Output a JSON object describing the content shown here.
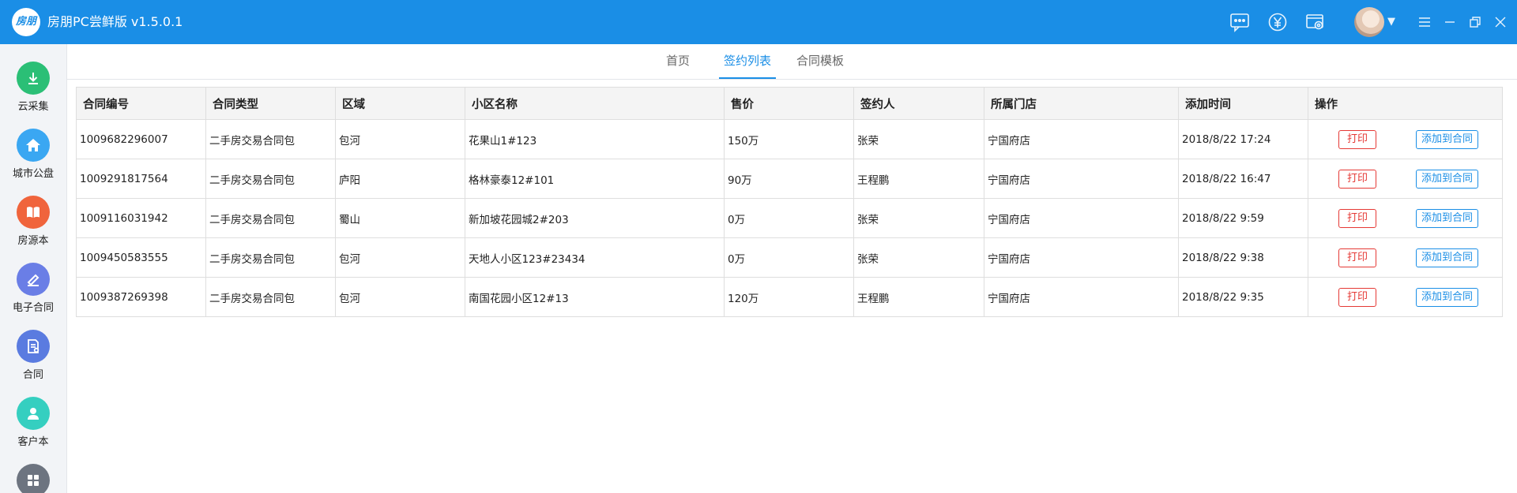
{
  "app": {
    "logo_text": "房朋",
    "title": "房朋PC尝鲜版 v1.5.0.1"
  },
  "titlebar_icons": [
    "message-icon",
    "yen-icon",
    "settings-icon"
  ],
  "sidebar": {
    "items": [
      {
        "label": "云采集",
        "icon": "download-cloud-icon",
        "color": "#2bbf76"
      },
      {
        "label": "城市公盘",
        "icon": "home-icon",
        "color": "#3aa7f2"
      },
      {
        "label": "房源本",
        "icon": "book-icon",
        "color": "#f0643c"
      },
      {
        "label": "电子合同",
        "icon": "pen-icon",
        "color": "#6a7ee6"
      },
      {
        "label": "合同",
        "icon": "document-icon",
        "color": "#5a7be0"
      },
      {
        "label": "客户本",
        "icon": "people-icon",
        "color": "#35cfc0"
      },
      {
        "label": "",
        "icon": "apps-icon",
        "color": "#6d7480"
      }
    ]
  },
  "tabs": [
    {
      "label": "首页",
      "active": false
    },
    {
      "label": "签约列表",
      "active": true
    },
    {
      "label": "合同模板",
      "active": false
    }
  ],
  "table": {
    "headers": [
      "合同编号",
      "合同类型",
      "区域",
      "小区名称",
      "售价",
      "签约人",
      "所属门店",
      "添加时间",
      "操作"
    ],
    "print_label": "打印",
    "add_label": "添加到合同",
    "rows": [
      [
        "1009682296007",
        "二手房交易合同包",
        "包河",
        "花果山1#123",
        "150万",
        "张荣",
        "宁国府店",
        "2018/8/22 17:24"
      ],
      [
        "1009291817564",
        "二手房交易合同包",
        "庐阳",
        "格林豪泰12#101",
        "90万",
        "王程鹏",
        "宁国府店",
        "2018/8/22 16:47"
      ],
      [
        "1009116031942",
        "二手房交易合同包",
        "蜀山",
        "新加坡花园城2#203",
        "0万",
        "张荣",
        "宁国府店",
        "2018/8/22 9:59"
      ],
      [
        "1009450583555",
        "二手房交易合同包",
        "包河",
        "天地人小区123#23434",
        "0万",
        "张荣",
        "宁国府店",
        "2018/8/22 9:38"
      ],
      [
        "1009387269398",
        "二手房交易合同包",
        "包河",
        "南国花园小区12#13",
        "120万",
        "王程鹏",
        "宁国府店",
        "2018/8/22 9:35"
      ]
    ]
  },
  "colors": {
    "titlebar": "#1a8ee6",
    "accent": "#1a8ee6",
    "danger": "#e53935"
  }
}
